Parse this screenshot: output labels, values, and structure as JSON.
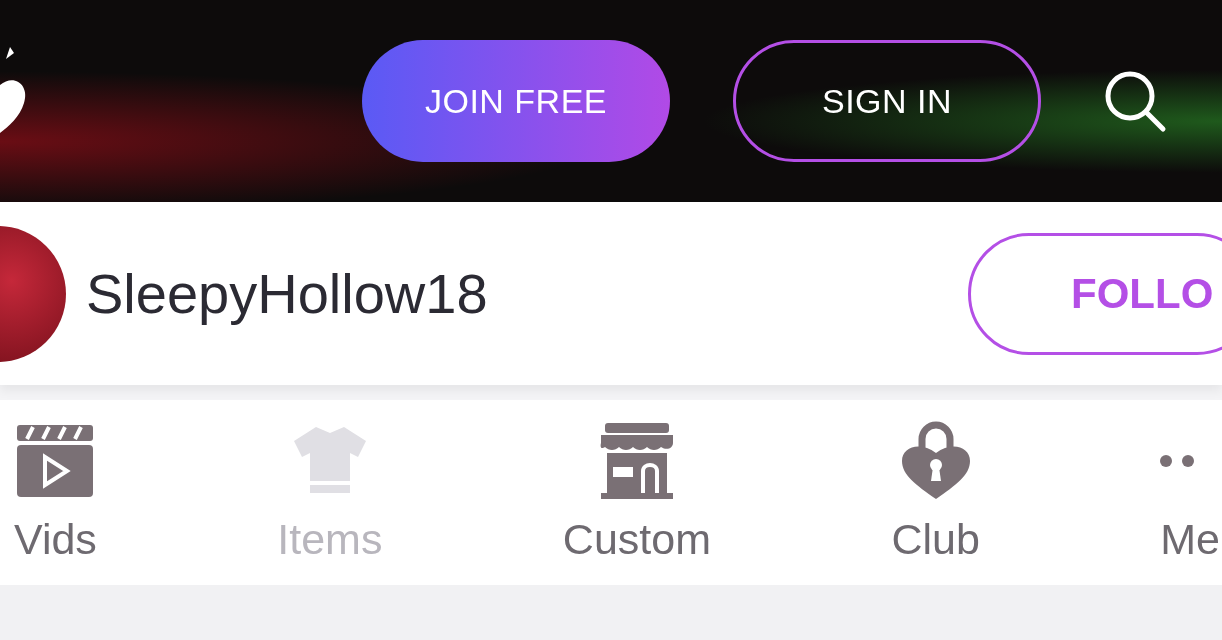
{
  "header": {
    "join_button": "JOIN FREE",
    "signin_button": "SIGN IN"
  },
  "profile": {
    "username": "SleepyHollow18",
    "follow_button": "FOLLO"
  },
  "nav": [
    {
      "label": "Vids",
      "disabled": false
    },
    {
      "label": "Items",
      "disabled": true
    },
    {
      "label": "Custom",
      "disabled": false
    },
    {
      "label": "Club",
      "disabled": false
    },
    {
      "label": "Me",
      "disabled": false
    }
  ]
}
